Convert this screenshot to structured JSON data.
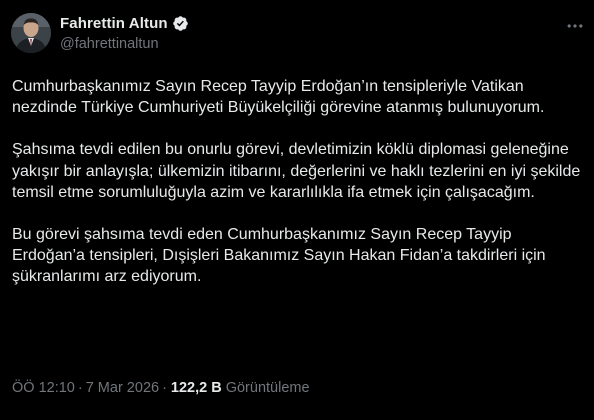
{
  "author": {
    "display_name": "Fahrettin Altun",
    "handle": "@fahrettinaltun",
    "verified_icon": "verified-badge-icon"
  },
  "tweet": {
    "paragraphs": [
      "Cumhurbaşkanımız Sayın Recep Tayyip Erdoğan’ın tensipleriyle Vatikan nezdinde Türkiye Cumhuriyeti Büyükelçiliği görevine atanmış bulunuyorum.",
      "Şahsıma tevdi edilen bu onurlu görevi, devletimizin köklü diplomasi geleneğine yakışır bir anlayışla; ülkemizin itibarını, değerlerini ve haklı tezlerini en iyi şekilde temsil etme sorumluluğuyla azim ve kararlılıkla ifa etmek için çalışacağım.",
      "Bu görevi şahsıma tevdi eden Cumhurbaşkanımız Sayın Recep Tayyip Erdoğan’a tensipleri, Dışişleri Bakanımız Sayın Hakan Fidan’a takdirleri için şükranlarımı arz ediyorum."
    ]
  },
  "meta": {
    "time": "ÖÖ 12:10",
    "separator": "·",
    "date": "7 Mar 2026",
    "separator2": "·",
    "views_count": "122,2 B",
    "views_label": "Görüntüleme"
  },
  "colors": {
    "background": "#000000",
    "text_primary": "#e7e9ea",
    "text_secondary": "#71767b",
    "verified": "#e7e9ea"
  }
}
